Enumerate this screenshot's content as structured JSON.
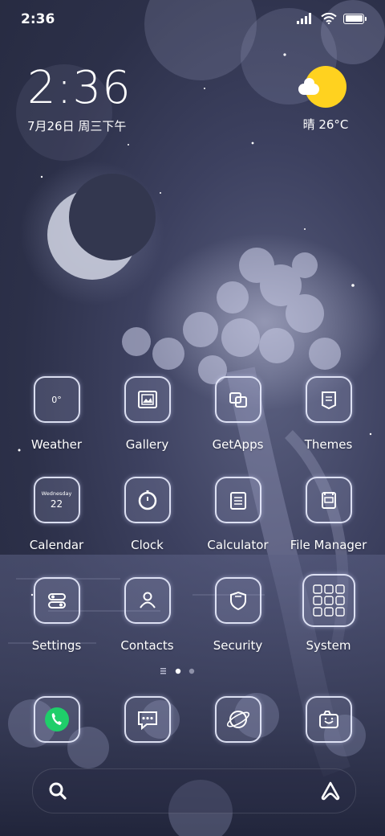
{
  "status_bar": {
    "time": "2:36",
    "icons": [
      "signal-icon",
      "wifi-icon",
      "battery-icon"
    ]
  },
  "clock_widget": {
    "time": "2:36",
    "date": "7月26日 周三下午"
  },
  "weather_widget": {
    "icon": "sun-with-cloud-icon",
    "text": "晴 26°C"
  },
  "apps": [
    {
      "label": "Weather",
      "icon": "weather-icon",
      "icon_text": "0°"
    },
    {
      "label": "Gallery",
      "icon": "gallery-icon"
    },
    {
      "label": "GetApps",
      "icon": "getapps-icon"
    },
    {
      "label": "Themes",
      "icon": "themes-icon"
    },
    {
      "label": "Calendar",
      "icon": "calendar-icon",
      "icon_text": "Wednesday",
      "icon_day": "22"
    },
    {
      "label": "Clock",
      "icon": "clock-icon"
    },
    {
      "label": "Calculator",
      "icon": "calculator-icon"
    },
    {
      "label": "File Manager",
      "icon": "file-manager-icon"
    },
    {
      "label": "Settings",
      "icon": "settings-icon"
    },
    {
      "label": "Contacts",
      "icon": "contacts-icon"
    },
    {
      "label": "Security",
      "icon": "security-icon"
    },
    {
      "label": "System",
      "icon": "system-folder-icon"
    }
  ],
  "pager": {
    "pages": 3,
    "current": 2
  },
  "dock": [
    {
      "icon": "phone-icon"
    },
    {
      "icon": "messages-icon"
    },
    {
      "icon": "browser-icon"
    },
    {
      "icon": "camera-icon"
    }
  ],
  "search_bar": {
    "search_icon": "search-icon",
    "assistant_icon": "assistant-icon"
  },
  "colors": {
    "sky": "#2c3049",
    "moon": "#c9ccdc",
    "sun": "#ffd21f",
    "phone_green": "#1fce6a"
  }
}
